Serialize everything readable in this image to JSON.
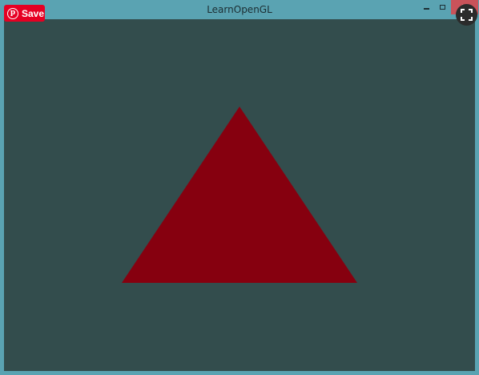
{
  "window": {
    "title": "LearnOpenGL"
  },
  "overlay": {
    "save_label": "Save",
    "pin_glyph": "p",
    "save_icon": "pinterest-icon",
    "expand_icon": "expand-icon"
  },
  "controls": {
    "minimize_icon": "minimize-icon",
    "maximize_icon": "maximize-icon",
    "close_icon": "close-icon"
  },
  "scene": {
    "clear_color": "#334d4d",
    "triangle_color": "#86000f",
    "shape": "triangle"
  }
}
